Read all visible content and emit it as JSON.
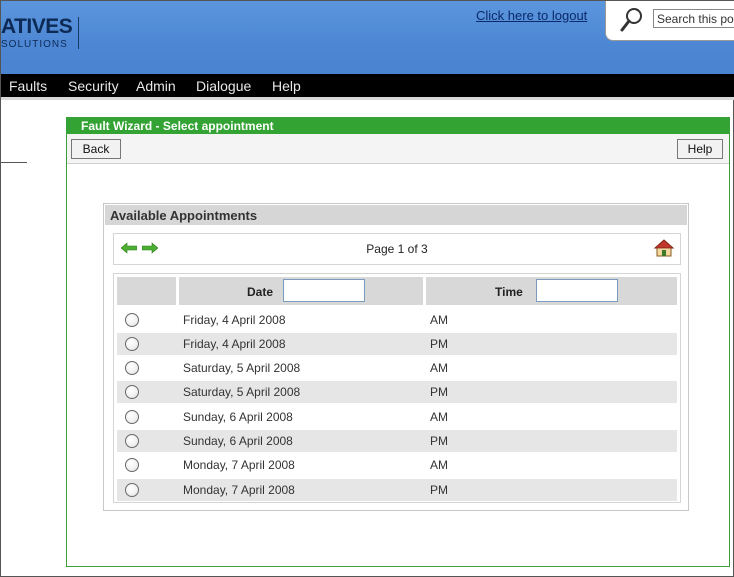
{
  "header": {
    "logo_text": "ATIVES",
    "logo_sub": "SOLUTIONS",
    "logout_label": "Click here to logout",
    "search_placeholder": "Search this portal"
  },
  "nav": {
    "items": [
      "Faults",
      "Security",
      "Admin",
      "Dialogue",
      "Help"
    ]
  },
  "wizard": {
    "title": "Fault Wizard - Select appointment",
    "back_label": "Back",
    "help_label": "Help"
  },
  "appointments": {
    "heading": "Available Appointments",
    "page_text": "Page 1 of 3",
    "columns": {
      "date": "Date",
      "time": "Time"
    },
    "rows": [
      {
        "date": "Friday, 4 April 2008",
        "time": "AM"
      },
      {
        "date": "Friday, 4 April 2008",
        "time": "PM"
      },
      {
        "date": "Saturday, 5 April 2008",
        "time": "AM"
      },
      {
        "date": "Saturday, 5 April 2008",
        "time": "PM"
      },
      {
        "date": "Sunday, 6 April 2008",
        "time": "AM"
      },
      {
        "date": "Sunday, 6 April 2008",
        "time": "PM"
      },
      {
        "date": "Monday, 7 April 2008",
        "time": "AM"
      },
      {
        "date": "Monday, 7 April 2008",
        "time": "PM"
      }
    ]
  },
  "icons": {
    "search": "search-icon",
    "prev": "arrow-left-icon",
    "next": "arrow-right-icon",
    "home": "home-icon"
  },
  "colors": {
    "header_blue": "#4d87d4",
    "nav_black": "#000000",
    "wizard_green": "#33a333",
    "arrow_green": "#4caf32"
  }
}
